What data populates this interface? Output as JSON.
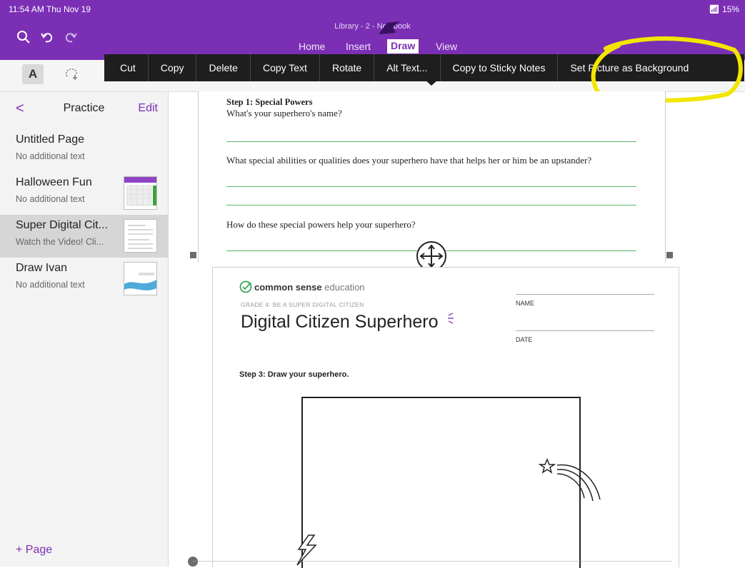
{
  "status": {
    "time": "11:54 AM  Thu Nov 19",
    "battery": "15%"
  },
  "notebook_title": "Library - 2 -          Notebook",
  "tabs": [
    {
      "label": "Home"
    },
    {
      "label": "Insert"
    },
    {
      "label": "Draw",
      "active": true
    },
    {
      "label": "View"
    }
  ],
  "ribbon": {
    "text_tool_label": "A"
  },
  "context_menu": {
    "items": [
      "Cut",
      "Copy",
      "Delete",
      "Copy Text",
      "Rotate",
      "Alt Text...",
      "Copy to Sticky Notes",
      "Set Picture as Background"
    ]
  },
  "sidebar": {
    "back": "<",
    "title": "Practice",
    "edit": "Edit",
    "pages": [
      {
        "title": "Untitled Page",
        "sub": "No additional text",
        "thumb": false
      },
      {
        "title": "Halloween Fun",
        "sub": "No additional text",
        "thumb": true
      },
      {
        "title": "Super Digital Cit...",
        "sub": "Watch the Video! Cli...",
        "thumb": true,
        "selected": true
      },
      {
        "title": "Draw Ivan",
        "sub": "No additional text",
        "thumb": true
      }
    ],
    "add_page": "+  Page"
  },
  "worksheet": {
    "step1_title": "Step 1: Special Powers",
    "q1": "What's your superhero's name?",
    "q2": "What special abilities or qualities does your superhero have that helps her or him be an upstander?",
    "q3": "How do these special powers help your superhero?"
  },
  "image": {
    "brand_bold": "common sense",
    "brand_light": " education",
    "grade": "GRADE 4: BE A SUPER DIGITAL CITIZEN",
    "title": "Digital Citizen Superhero",
    "name_label": "NAME",
    "date_label": "DATE",
    "step3": "Step 3: Draw your superhero."
  },
  "colors": {
    "accent": "#7b2fb5",
    "menu_bg": "#1e1e1e",
    "highlight": "#f2e600",
    "worksheet_line": "#5fb36b"
  }
}
